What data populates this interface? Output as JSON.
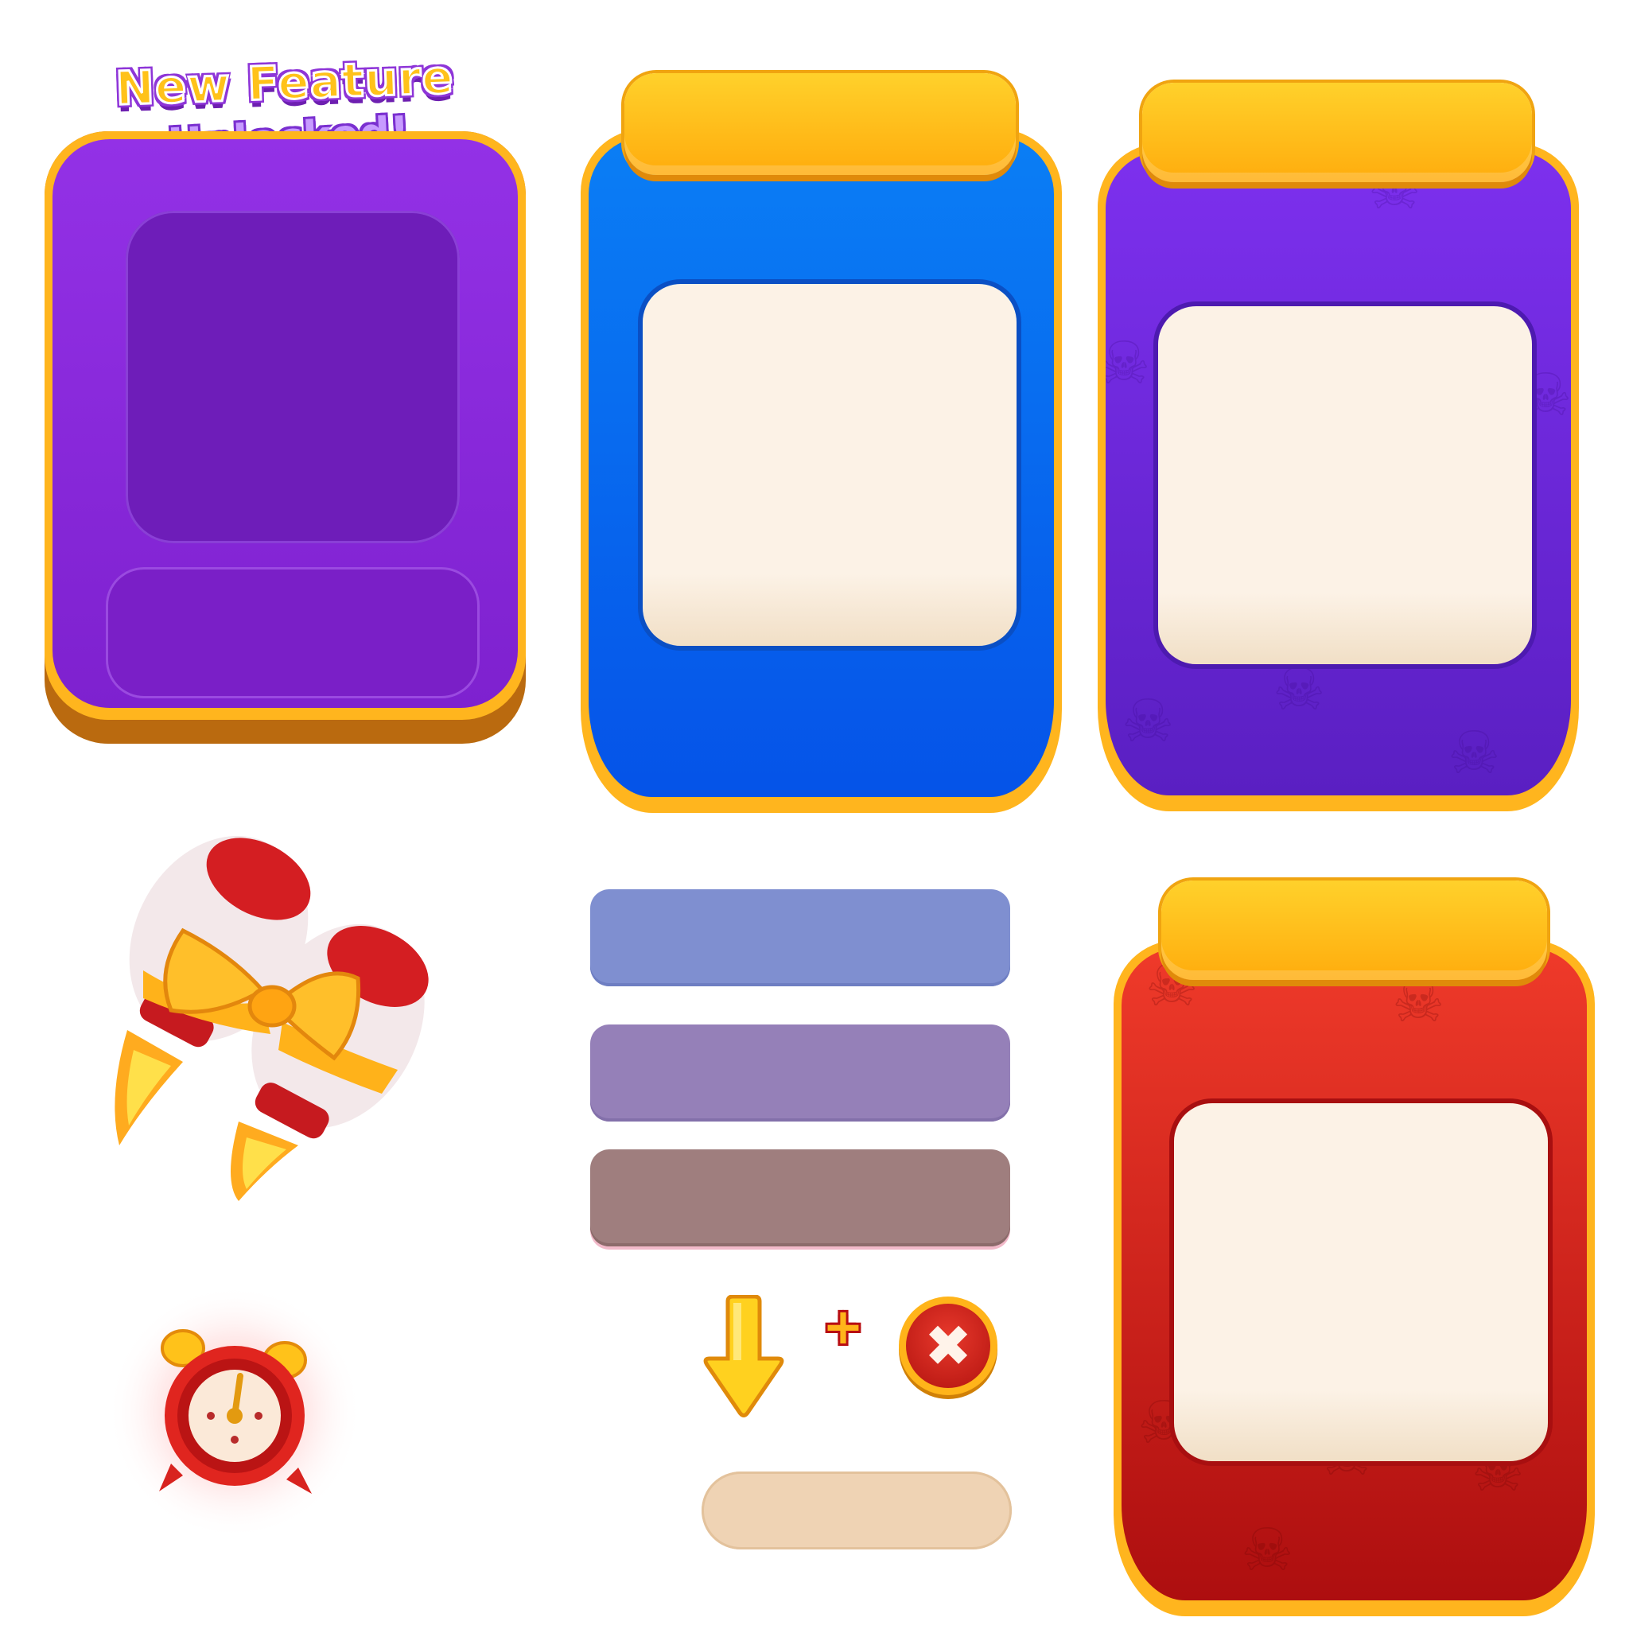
{
  "banner": {
    "line1": "New Feature",
    "line2": "Unlocked!"
  },
  "icons": {
    "rocket": "jetpack-rockets-icon",
    "clock": "alarm-clock-icon",
    "arrow": "arrow-down-icon",
    "plus": "plus-icon",
    "close": "close-icon"
  },
  "plus_symbol": "+",
  "close_symbol": "✖",
  "colors": {
    "gold": "#ffb51e",
    "purple": "#9331e6",
    "blue": "#0a7ef5",
    "violet": "#7d30ee",
    "red": "#ef3a2a",
    "cream": "#fcf2e6"
  }
}
